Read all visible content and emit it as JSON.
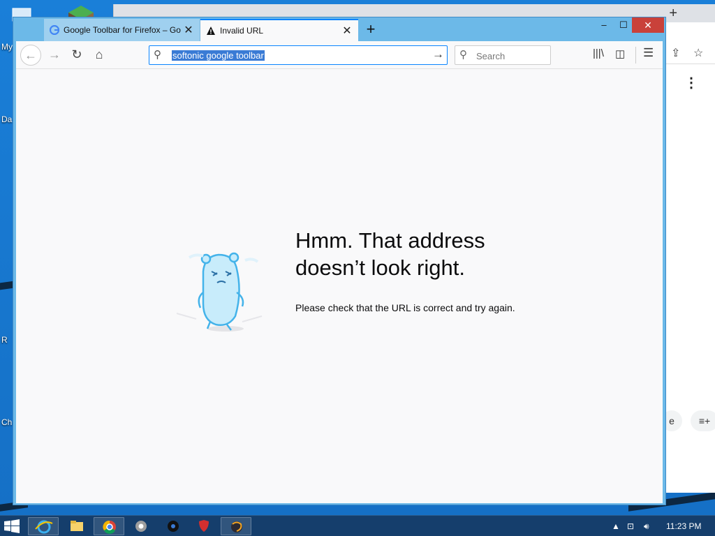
{
  "desktop": {
    "labels": [
      "My",
      "Da",
      "R",
      "Ch"
    ]
  },
  "background_window": {
    "new_tab_symbol": "+",
    "chip_label": "e",
    "menu_symbol": "⋮",
    "list_add_symbol": "≡+"
  },
  "browser": {
    "tabs": [
      {
        "title": "Google Toolbar for Firefox – Go",
        "icon": "google-g-icon",
        "close": "✕"
      },
      {
        "title": "Invalid URL",
        "icon": "warning-icon",
        "close": "✕"
      }
    ],
    "new_tab_label": "+",
    "window_controls": {
      "minimize": "–",
      "maximize": "☐",
      "close": "✕"
    },
    "url_value": "softonic google toolbar",
    "search_placeholder": "Search",
    "accent_color": "#0a84ff"
  },
  "error_page": {
    "title_line1": "Hmm. That address",
    "title_line2": "doesn’t look right.",
    "description": "Please check that the URL is correct and try again."
  },
  "taskbar": {
    "apps": [
      "internet-explorer",
      "file-explorer",
      "chrome",
      "chrome-dev",
      "app-dark",
      "app-red-shield",
      "firefox-nightly"
    ],
    "clock": "11:23 PM"
  }
}
